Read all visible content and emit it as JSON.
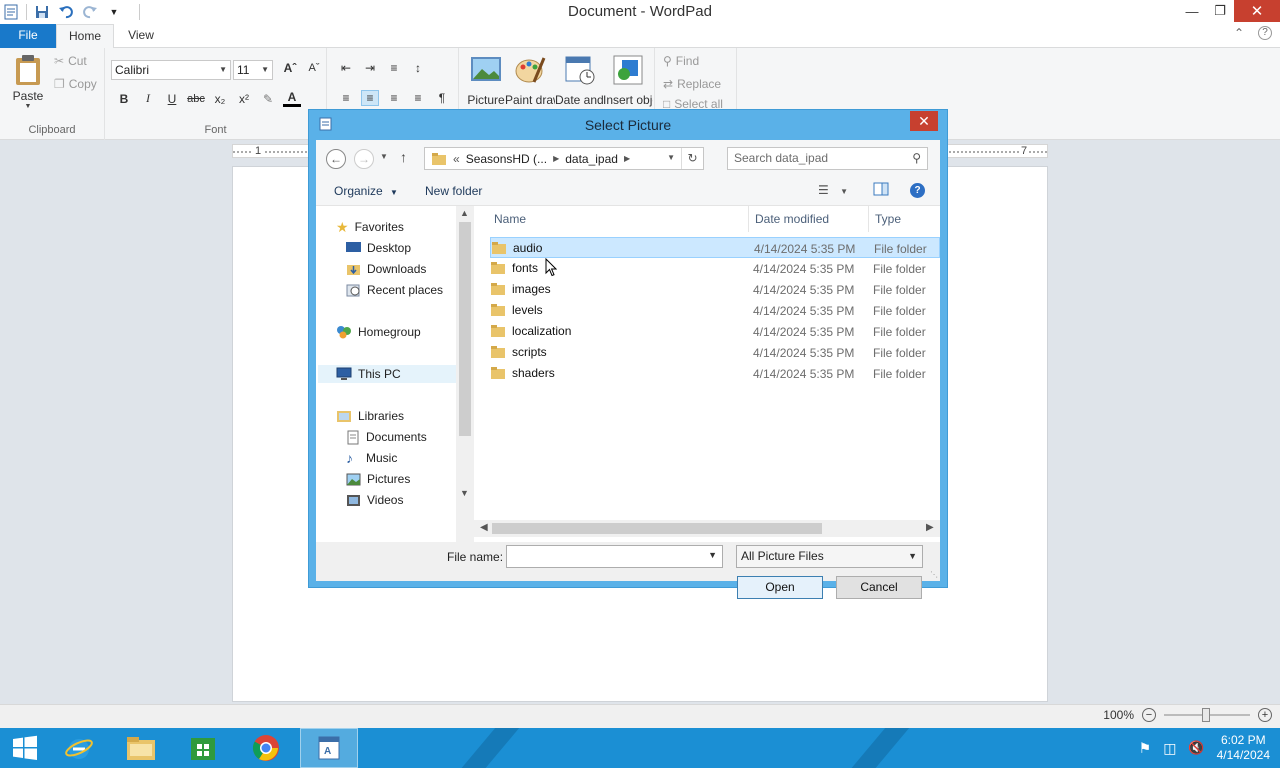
{
  "app": {
    "window_title": "Document - WordPad"
  },
  "ribbon": {
    "tabs": [
      "File",
      "Home",
      "View"
    ],
    "clipboard": {
      "paste": "Paste",
      "cut": "Cut",
      "copy": "Copy",
      "label": "Clipboard"
    },
    "font": {
      "family": "Calibri",
      "size": "11",
      "label": "Font"
    },
    "insert": {
      "picture": "Picture",
      "paint": "Paint drawing",
      "datetime": "Date and time",
      "object": "Insert object"
    },
    "editing": {
      "find": "Find",
      "replace": "Replace",
      "select_all": "Select all"
    }
  },
  "ruler": {
    "left_mark": "1",
    "right_mark": "7"
  },
  "dialog": {
    "title": "Select Picture",
    "address": {
      "crumb_prefix": "«",
      "crumb1": "SeasonsHD (...",
      "crumb2": "data_ipad"
    },
    "search_placeholder": "Search data_ipad",
    "toolbar": {
      "organize": "Organize",
      "new_folder": "New folder"
    },
    "nav": {
      "favorites": "Favorites",
      "desktop": "Desktop",
      "downloads": "Downloads",
      "recent": "Recent places",
      "homegroup": "Homegroup",
      "this_pc": "This PC",
      "libraries": "Libraries",
      "documents": "Documents",
      "music": "Music",
      "pictures": "Pictures",
      "videos": "Videos"
    },
    "columns": {
      "name": "Name",
      "date": "Date modified",
      "type": "Type"
    },
    "files": [
      {
        "name": "audio",
        "date": "4/14/2024 5:35 PM",
        "type": "File folder"
      },
      {
        "name": "fonts",
        "date": "4/14/2024 5:35 PM",
        "type": "File folder"
      },
      {
        "name": "images",
        "date": "4/14/2024 5:35 PM",
        "type": "File folder"
      },
      {
        "name": "levels",
        "date": "4/14/2024 5:35 PM",
        "type": "File folder"
      },
      {
        "name": "localization",
        "date": "4/14/2024 5:35 PM",
        "type": "File folder"
      },
      {
        "name": "scripts",
        "date": "4/14/2024 5:35 PM",
        "type": "File folder"
      },
      {
        "name": "shaders",
        "date": "4/14/2024 5:35 PM",
        "type": "File folder"
      }
    ],
    "file_name_label": "File name:",
    "file_name_value": "",
    "filter": "All Picture Files",
    "open": "Open",
    "cancel": "Cancel"
  },
  "status": {
    "zoom": "100%"
  },
  "taskbar": {
    "time": "6:02 PM",
    "date": "4/14/2024"
  },
  "colors": {
    "accent": "#1979ca",
    "dialog_frame": "#5ab1e8",
    "taskbar": "#1b8fd4",
    "selection": "#cce8ff"
  }
}
